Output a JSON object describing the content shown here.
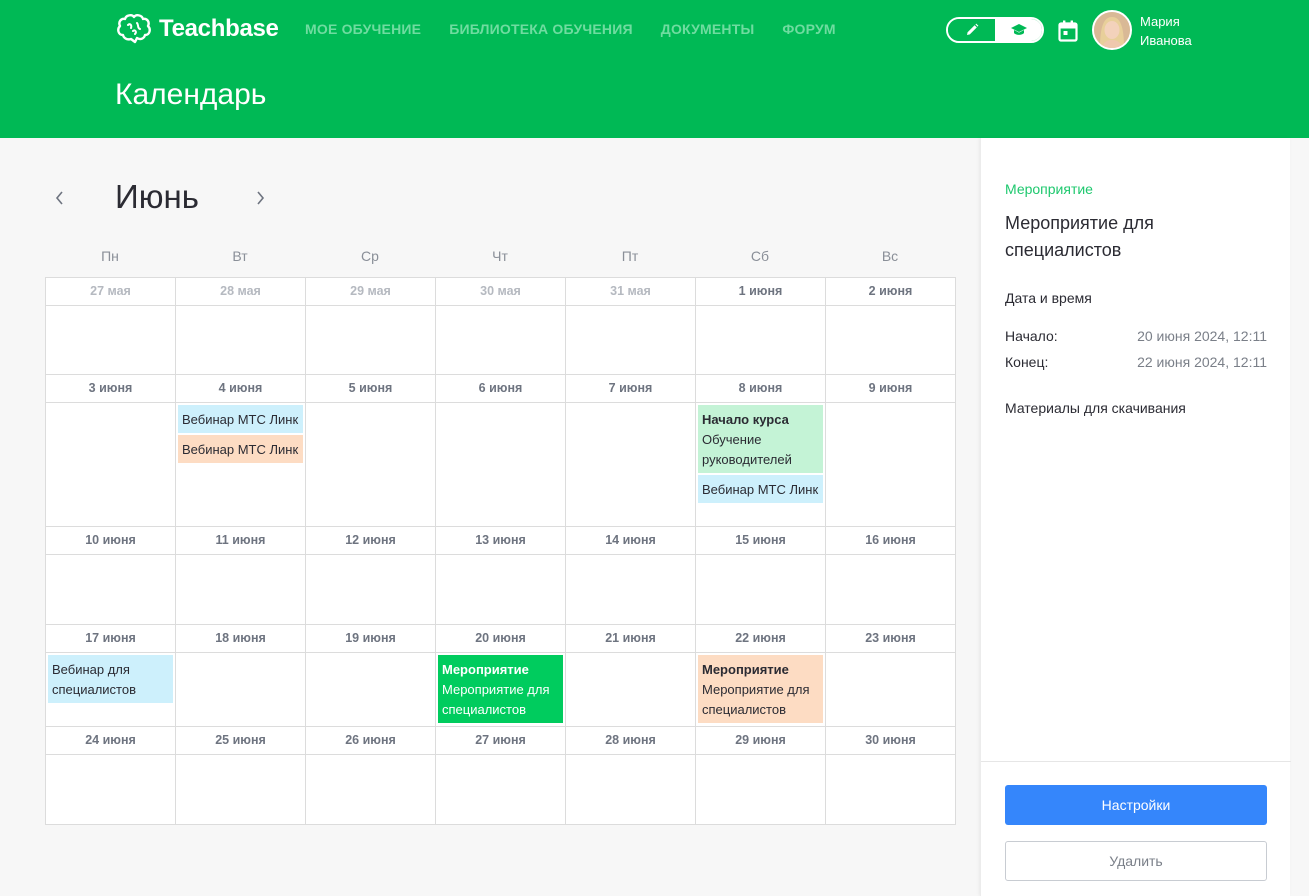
{
  "header": {
    "logo_text": "Teachbase",
    "nav": [
      "МОЕ ОБУЧЕНИЕ",
      "БИБЛИОТЕКА ОБУЧЕНИЯ",
      "ДОКУМЕНТЫ",
      "ФОРУМ"
    ],
    "user": {
      "first_name": "Мария",
      "last_name": "Иванова"
    },
    "page_title": "Календарь",
    "icons": {
      "logo": "brain-icon",
      "edit_mode": "pencil-icon",
      "learn_mode": "graduation-cap-icon",
      "calendar": "calendar-icon"
    }
  },
  "calendar": {
    "month": "Июнь",
    "weekdays": [
      "Пн",
      "Вт",
      "Ср",
      "Чт",
      "Пт",
      "Сб",
      "Вс"
    ],
    "weeks": [
      {
        "days": [
          {
            "label": "27 мая",
            "muted": true,
            "events": []
          },
          {
            "label": "28 мая",
            "muted": true,
            "events": []
          },
          {
            "label": "29 мая",
            "muted": true,
            "events": []
          },
          {
            "label": "30 мая",
            "muted": true,
            "events": []
          },
          {
            "label": "31 мая",
            "muted": true,
            "events": []
          },
          {
            "label": "1 июня",
            "muted": false,
            "events": []
          },
          {
            "label": "2 июня",
            "muted": false,
            "events": []
          }
        ]
      },
      {
        "days": [
          {
            "label": "3 июня",
            "muted": false,
            "events": []
          },
          {
            "label": "4 июня",
            "muted": false,
            "events": [
              {
                "type": "",
                "title": "Вебинар МТС Линк",
                "color": "blue"
              },
              {
                "type": "",
                "title": "Вебинар МТС Линк",
                "color": "peach"
              }
            ]
          },
          {
            "label": "5 июня",
            "muted": false,
            "events": []
          },
          {
            "label": "6 июня",
            "muted": false,
            "events": []
          },
          {
            "label": "7 июня",
            "muted": false,
            "events": []
          },
          {
            "label": "8 июня",
            "muted": false,
            "events": [
              {
                "type": "Начало курса",
                "title": "Обучение руководителей",
                "color": "mint"
              },
              {
                "type": "",
                "title": "Вебинар МТС Линк",
                "color": "blue"
              }
            ]
          },
          {
            "label": "9 июня",
            "muted": false,
            "events": []
          }
        ]
      },
      {
        "days": [
          {
            "label": "10 июня",
            "muted": false,
            "events": []
          },
          {
            "label": "11 июня",
            "muted": false,
            "events": []
          },
          {
            "label": "12 июня",
            "muted": false,
            "events": []
          },
          {
            "label": "13 июня",
            "muted": false,
            "events": []
          },
          {
            "label": "14 июня",
            "muted": false,
            "events": []
          },
          {
            "label": "15 июня",
            "muted": false,
            "events": []
          },
          {
            "label": "16 июня",
            "muted": false,
            "events": []
          }
        ]
      },
      {
        "days": [
          {
            "label": "17 июня",
            "muted": false,
            "events": [
              {
                "type": "",
                "title": "Вебинар для специалистов",
                "color": "blue"
              }
            ]
          },
          {
            "label": "18 июня",
            "muted": false,
            "events": []
          },
          {
            "label": "19 июня",
            "muted": false,
            "events": []
          },
          {
            "label": "20 июня",
            "muted": false,
            "events": [
              {
                "type": "Мероприятие",
                "title": "Мероприятие для специалистов",
                "color": "green"
              }
            ]
          },
          {
            "label": "21 июня",
            "muted": false,
            "events": []
          },
          {
            "label": "22 июня",
            "muted": false,
            "events": [
              {
                "type": "Мероприятие",
                "title": "Мероприятие для специалистов",
                "color": "peach"
              }
            ]
          },
          {
            "label": "23 июня",
            "muted": false,
            "events": []
          }
        ]
      },
      {
        "days": [
          {
            "label": "24 июня",
            "muted": false,
            "events": []
          },
          {
            "label": "25 июня",
            "muted": false,
            "events": []
          },
          {
            "label": "26 июня",
            "muted": false,
            "events": []
          },
          {
            "label": "27 июня",
            "muted": false,
            "events": []
          },
          {
            "label": "28 июня",
            "muted": false,
            "events": []
          },
          {
            "label": "29 июня",
            "muted": false,
            "events": []
          },
          {
            "label": "30 июня",
            "muted": false,
            "events": []
          }
        ]
      }
    ]
  },
  "panel": {
    "type": "Мероприятие",
    "title": "Мероприятие для специалистов",
    "datetime_heading": "Дата и время",
    "start_label": "Начало:",
    "start_value": "20 июня 2024, 12:11",
    "end_label": "Конец:",
    "end_value": "22 июня 2024, 12:11",
    "materials_heading": "Материалы для скачивания",
    "settings_button": "Настройки",
    "delete_button": "Удалить"
  },
  "colors": {
    "brand": "#00b955",
    "primary_button": "#3586fb",
    "event_blue": "#cdf0fc",
    "event_peach": "#fddcc3",
    "event_mint": "#c4f3d6",
    "event_green": "#00cc5e"
  }
}
